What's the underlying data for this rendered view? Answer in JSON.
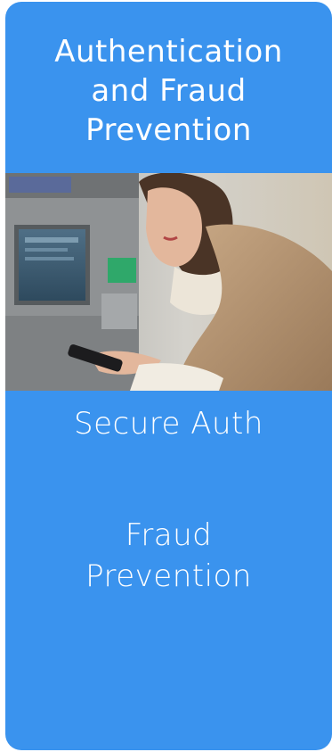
{
  "card": {
    "title_line1": "Authentication",
    "title_line2": "and Fraud",
    "title_line3": "Prevention",
    "item1": "Secure Auth",
    "item2_line1": "Fraud",
    "item2_line2": "Prevention"
  },
  "colors": {
    "card_background": "#3a93ee",
    "text": "#ffffff"
  },
  "image": {
    "icon": "woman-at-atm-with-phone-photo"
  }
}
